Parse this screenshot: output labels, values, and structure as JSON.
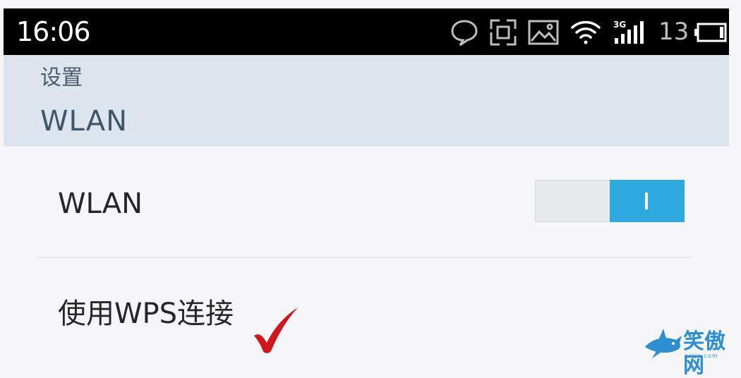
{
  "status_bar": {
    "time": "16:06",
    "network_type": "3G",
    "battery_level": "13",
    "icons": [
      "chat-bubble-icon",
      "qr-scan-icon",
      "image-icon",
      "wifi-icon",
      "signal-3g-icon",
      "battery-icon"
    ]
  },
  "header": {
    "breadcrumb": "设置",
    "title": "WLAN"
  },
  "settings": {
    "wlan_label": "WLAN",
    "wlan_toggle_state": "on",
    "wps_label": "使用WPS连接"
  },
  "watermark": {
    "text": "笑傲网",
    "sub": "xajjn.com"
  },
  "colors": {
    "accent": "#2ea9e0",
    "header_bg": "#dce4ed",
    "checkmark": "#d0151c"
  }
}
